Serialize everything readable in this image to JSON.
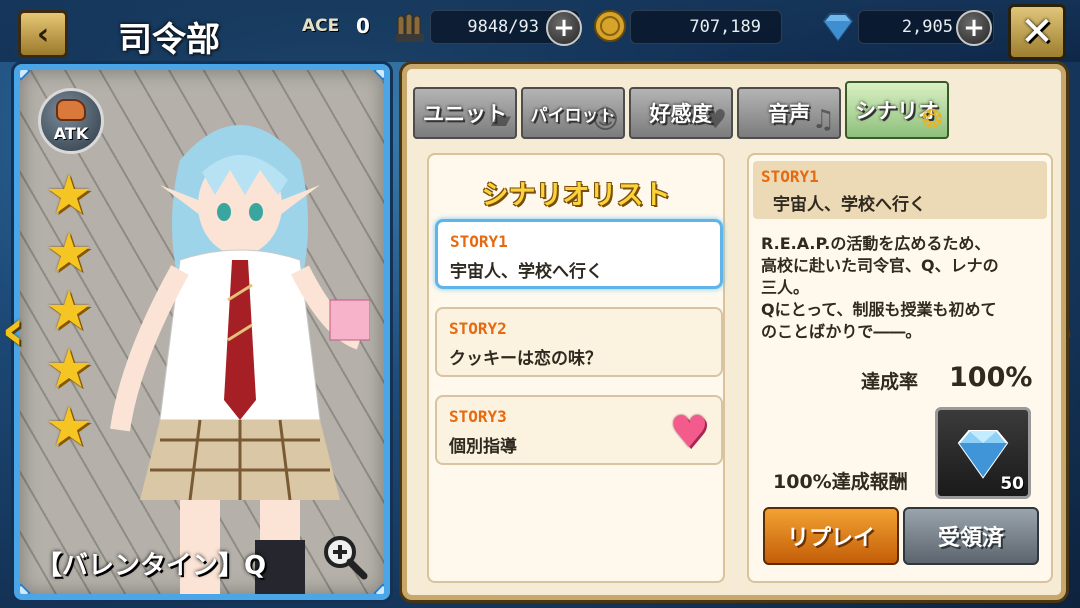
{
  "header": {
    "back_icon": "back-arrow-icon",
    "title": "司令部",
    "ace_label": "ACE",
    "ace_value": "0",
    "ammo_value": "9848/93",
    "coin_value": "707,189",
    "gem_value": "2,905",
    "close_icon": "close-x-icon"
  },
  "character": {
    "role_badge": "ATK",
    "stars": 5,
    "name": "【バレンタイン】Q",
    "zoom_icon": "zoom-in-icon"
  },
  "tabs": [
    {
      "label": "ユニット",
      "active": false
    },
    {
      "label": "パイロット",
      "active": false
    },
    {
      "label": "好感度",
      "active": false
    },
    {
      "label": "音声",
      "active": false
    },
    {
      "label": "シナリオ",
      "active": true
    }
  ],
  "scenario_list": {
    "title": "シナリオリスト",
    "items": [
      {
        "id": "STORY1",
        "title": "宇宙人、学校へ行く",
        "selected": true
      },
      {
        "id": "STORY2",
        "title": "クッキーは恋の味？",
        "selected": false
      },
      {
        "id": "STORY3",
        "title": "個別指導",
        "selected": false,
        "icon": "heart-icon"
      }
    ]
  },
  "detail": {
    "id": "STORY1",
    "title": "宇宙人、学校へ行く",
    "description": "R.E.A.P.の活動を広めるため、\n高校に赴いた司令官、Q、レナの\n三人。\nQにとって、制服も授業も初めて\nのことばかりで――。",
    "completion_label": "達成率",
    "completion_value": "100%",
    "reward_label": "100%達成報酬",
    "reward_icon": "diamond-icon",
    "reward_qty": "50",
    "replay_button": "リプレイ",
    "claimed_button": "受領済"
  },
  "colors": {
    "accent_orange": "#e56a12",
    "card_border": "#4aa6e6",
    "panel_bg": "#f6ecd6",
    "star": "#f5c623"
  }
}
